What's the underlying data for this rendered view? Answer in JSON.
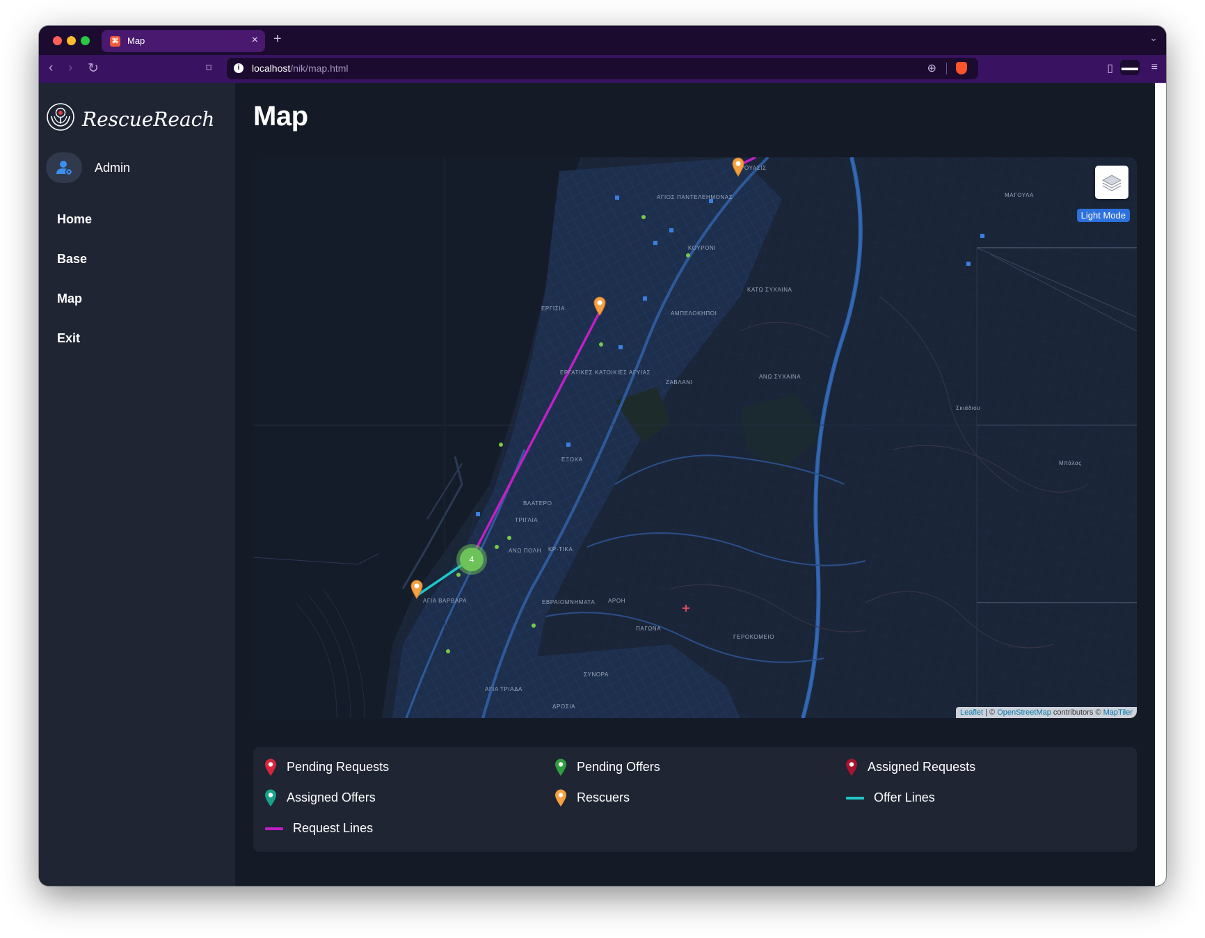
{
  "browser": {
    "tab_title": "Map",
    "tab_close": "×",
    "new_tab": "+",
    "url_host": "localhost",
    "url_path": "/nik/map.html"
  },
  "sidebar": {
    "brand": "RescueReach",
    "user": "Admin",
    "items": [
      {
        "label": "Home"
      },
      {
        "label": "Base"
      },
      {
        "label": "Map"
      },
      {
        "label": "Exit"
      }
    ]
  },
  "main": {
    "title": "Map"
  },
  "map": {
    "light_mode_label": "Light Mode",
    "cluster_count": "4",
    "attribution": {
      "leaflet": "Leaflet",
      "sep": " | © ",
      "osm": "OpenStreetMap",
      "contributors": " contributors © ",
      "maptiler": "MapTiler"
    },
    "place_labels": [
      "ΑΓΙΟΣ ΠΑΝΤΕΛΕΗΜΟΝΑΣ",
      "ΚΟΥΡΟΝΙ",
      "ΚΑΤΩ ΣΥΧΑΙΝΑ",
      "ΓΕΡΟΚΟΜΕΙΟ",
      "ΑΜΠΕΛΟΚΗΠΟΙ",
      "ΖΑΒΛΑΝΙ",
      "ΑΝΩ ΣΥΧΑΙΝΑ",
      "ΕΡΓΑΤΙΚΕΣ ΚΑΤΟΙΚΙΕΣ ΑΓΥΙΑΣ",
      "ΕΞΟΧΑ",
      "ΒΛΑΤΕΡΟ",
      "ΤΡΙΓΛΙΑ",
      "ΑΝΩ ΠΟΛΗ",
      "ΚΡ-ΤΙΚΑ",
      "ΕΒΡΑΙΟΜΝΗΜΑΤΑ",
      "ΑΡΟΗ",
      "ΠΑΓΩΝΑ",
      "ΑΓΙΑ ΒΑΡΒΑΡΑ",
      "ΣΥΝΟΡΑ",
      "ΑΓΙΑ ΤΡΙΑΔΑ",
      "ΔΡΟΣΙΑ",
      "ΜΑΓΟΥΛΑ",
      "Σκιάδιου",
      "Μπάλας",
      "ΡΟΥΑΣΙΣ",
      "ΕΡΓΙΣΙΑ"
    ],
    "marker_colors": {
      "rescuer": "#f4a043",
      "request_line": "#c21fc7",
      "offer_line": "#1ec8c8",
      "cluster": "#6dc35a"
    }
  },
  "legend": [
    {
      "label": "Pending Requests",
      "icon": "red-pin-icon",
      "color": "#d7263d"
    },
    {
      "label": "Pending Offers",
      "icon": "green-pin-icon",
      "color": "#2e9e3e"
    },
    {
      "label": "Assigned Requests",
      "icon": "dark-red-pin-icon",
      "color": "#a8142e"
    },
    {
      "label": "Assigned Offers",
      "icon": "teal-pin-icon",
      "color": "#17a38a"
    },
    {
      "label": "Rescuers",
      "icon": "orange-pin-icon",
      "color": "#f4a043"
    },
    {
      "label": "Offer Lines",
      "icon": "offer-line-icon",
      "color": "#1ec8c8"
    },
    {
      "label": "Request Lines",
      "icon": "request-line-icon",
      "color": "#c21fc7"
    }
  ]
}
